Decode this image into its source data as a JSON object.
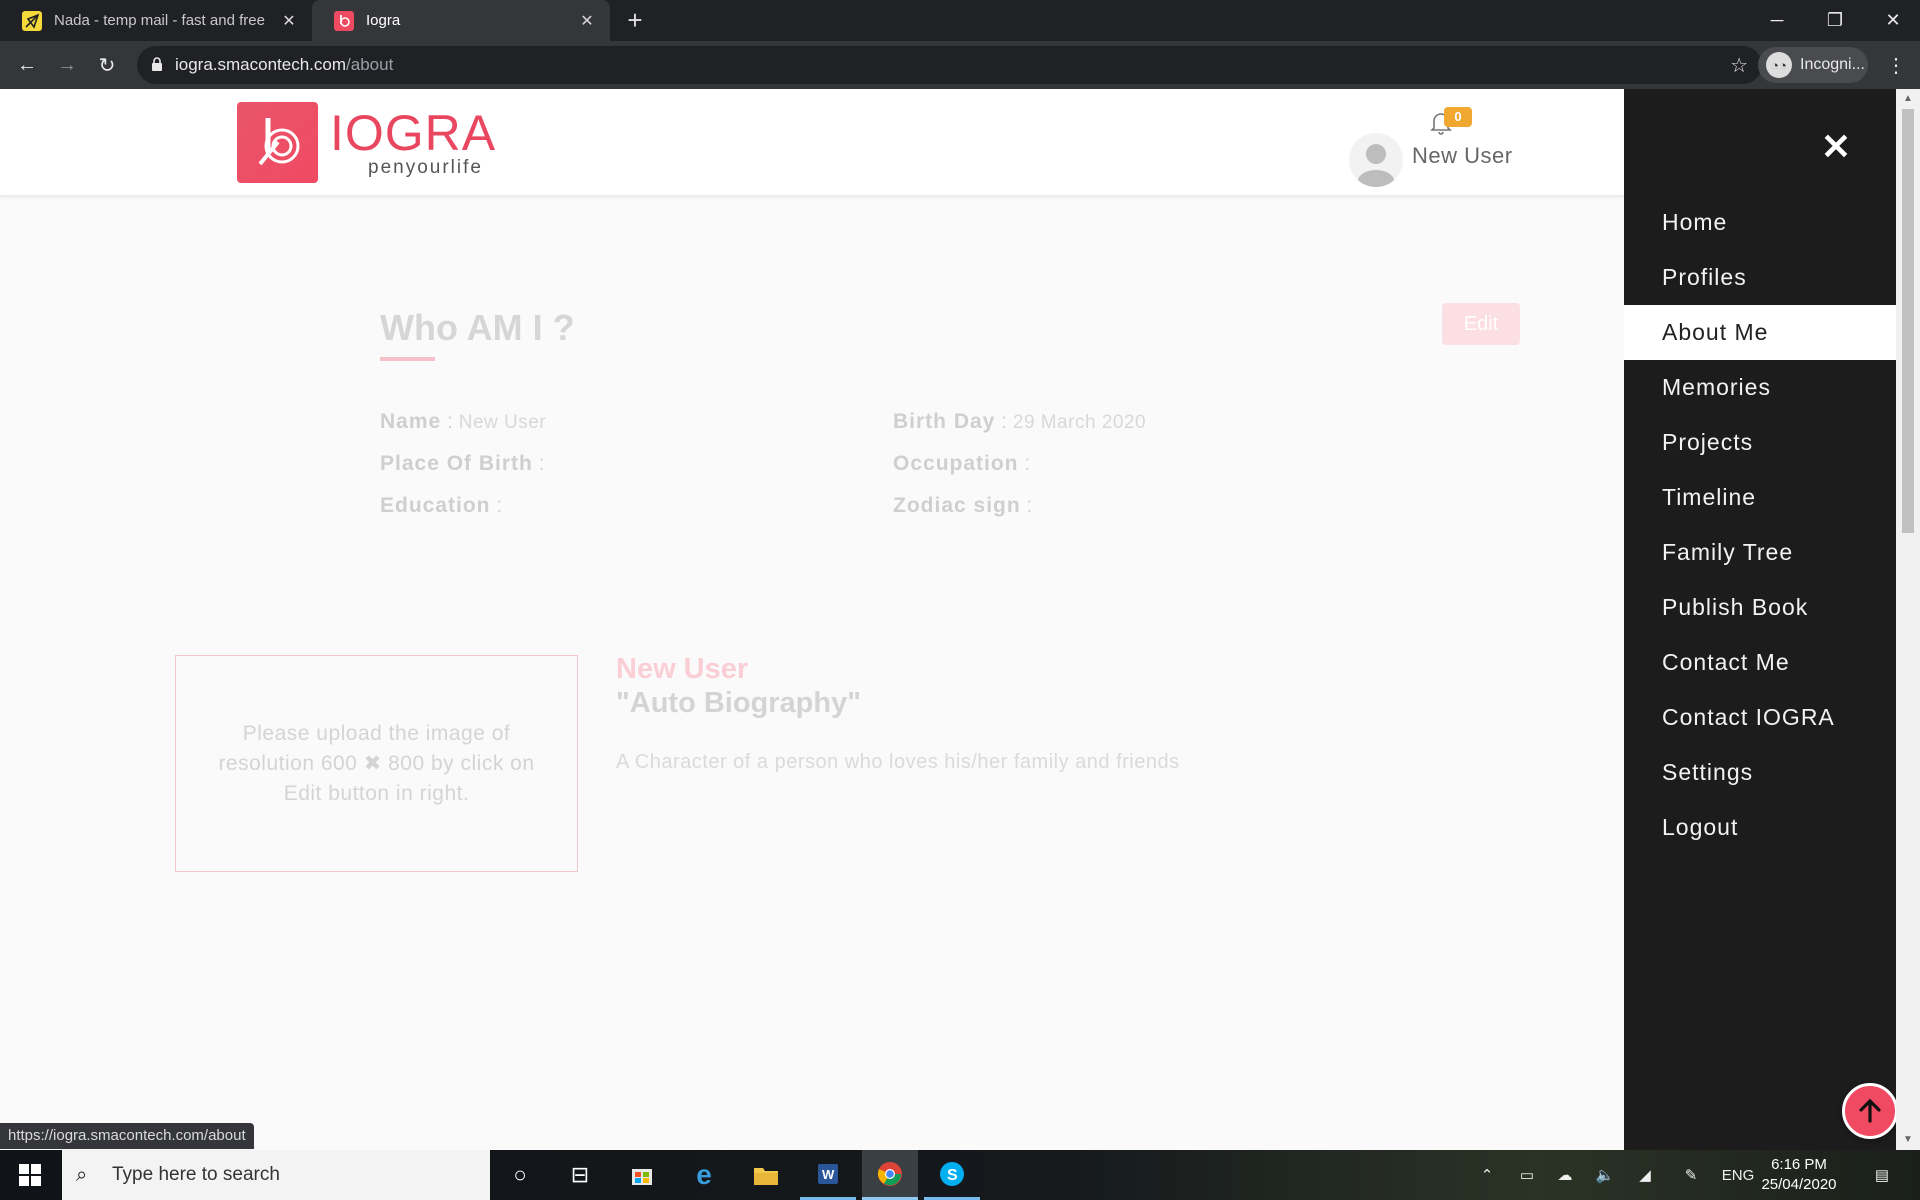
{
  "browser": {
    "tabs": [
      {
        "title": "Nada - temp mail - fast and free",
        "favicon": "nada-envelope-icon",
        "active": false
      },
      {
        "title": "Iogra",
        "favicon": "iogra-logo-icon",
        "active": true
      }
    ],
    "url_host": "iogra.smacontech.com",
    "url_path": "/about",
    "profile_label": "Incogni...",
    "status_url": "https://iogra.smacontech.com/about"
  },
  "site": {
    "logo_title": "IOGRA",
    "logo_tagline": "penyourlife",
    "notification_count": "0",
    "user_name": "New User",
    "brand_color": "#f04a63"
  },
  "about": {
    "heading": "Who AM I ?",
    "edit_label": "Edit",
    "fields": {
      "name_label": "Name",
      "name_value": "New User",
      "birthday_label": "Birth Day",
      "birthday_value": "29 March 2020",
      "place_label": "Place Of Birth",
      "place_value": "",
      "occupation_label": "Occupation",
      "occupation_value": "",
      "education_label": "Education",
      "education_value": "",
      "zodiac_label": "Zodiac sign",
      "zodiac_value": ""
    },
    "upload_hint": "Please upload the image of resolution 600 ✖ 800 by click on Edit button in right.",
    "bio_name": "New User",
    "bio_title": "\"Auto Biography\"",
    "bio_description": "A Character of a person who loves his/her family and friends"
  },
  "menu": {
    "items": [
      {
        "label": "Home"
      },
      {
        "label": "Profiles"
      },
      {
        "label": "About Me"
      },
      {
        "label": "Memories"
      },
      {
        "label": "Projects"
      },
      {
        "label": "Timeline"
      },
      {
        "label": "Family Tree"
      },
      {
        "label": "Publish Book"
      },
      {
        "label": "Contact Me"
      },
      {
        "label": "Contact IOGRA"
      },
      {
        "label": "Settings"
      },
      {
        "label": "Logout"
      }
    ],
    "active_item": "About Me"
  },
  "taskbar": {
    "search_placeholder": "Type here to search",
    "language": "ENG",
    "time": "6:16 PM",
    "date": "25/04/2020"
  }
}
